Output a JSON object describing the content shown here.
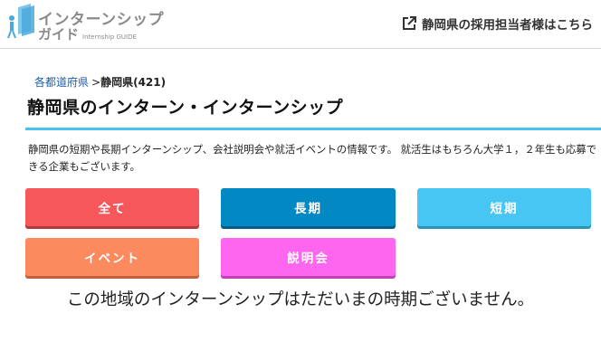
{
  "header": {
    "logo_line1": "インターンシップ",
    "logo_line2": "ガイド",
    "logo_sub": "Internship GUIDE",
    "link_label": "静岡県の採用担当者様はこちら",
    "link_icon": "external-link-icon"
  },
  "breadcrumb": {
    "parent_label": "各都道府県",
    "separator": ">",
    "current_label": "静岡県(421)"
  },
  "page_title": "静岡県のインターン・インターンシップ",
  "description": "静岡県の短期や長期インターンシップ、会社説明会や就活イベントの情報です。 就活生はもちろん大学１，２年生も応募できる企業もございます。",
  "filters": {
    "all": "全て",
    "long": "長期",
    "short": "短期",
    "event": "イベント",
    "info_session": "説明会"
  },
  "colors": {
    "accent_rule": "#48c2f0",
    "all": "#f5575a",
    "long": "#0289c4",
    "short": "#47c5f3",
    "event": "#fb8a5e",
    "info_session": "#ff66f0",
    "link": "#1a5dad"
  },
  "empty_message": "この地域のインターンシップはただいまの時期ございません。"
}
